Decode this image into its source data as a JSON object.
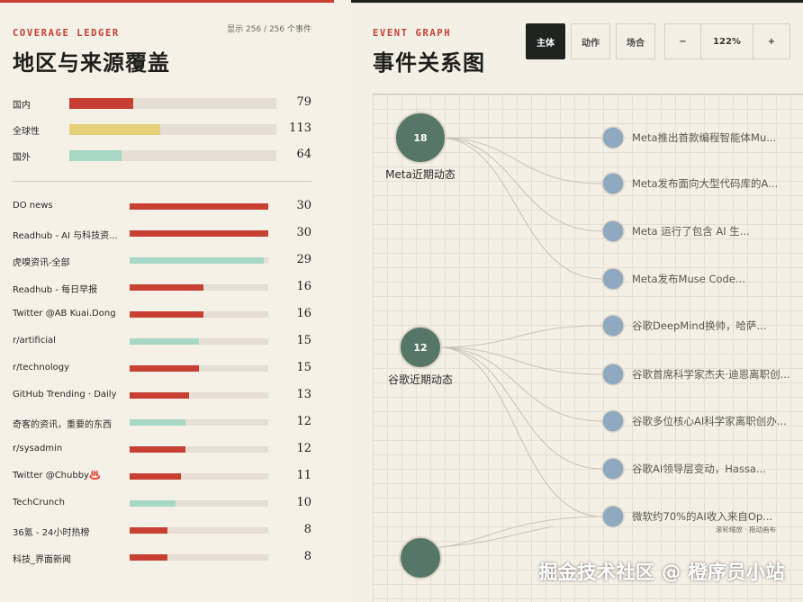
{
  "coverage": {
    "kicker": "COVERAGE LEDGER",
    "title": "地区与来源覆盖",
    "count_text": "显示 256 / 256 个事件",
    "regions": [
      {
        "label": "国内",
        "value": 79,
        "fraction": 0.31,
        "color": "#c83f33"
      },
      {
        "label": "全球性",
        "value": 113,
        "fraction": 0.44,
        "color": "#e8cf7a"
      },
      {
        "label": "国外",
        "value": 64,
        "fraction": 0.25,
        "color": "#a7d8c5"
      }
    ],
    "sources": [
      {
        "label": "DO news",
        "value": 30,
        "fraction": 1.0,
        "color": "#c83f33"
      },
      {
        "label": "Readhub - AI 与科技资...",
        "value": 30,
        "fraction": 1.0,
        "color": "#c83f33"
      },
      {
        "label": "虎嗅资讯-全部",
        "value": 29,
        "fraction": 0.97,
        "color": "#a7d8c5"
      },
      {
        "label": "Readhub - 每日早报",
        "value": 16,
        "fraction": 0.53,
        "color": "#c83f33"
      },
      {
        "label": "Twitter @AB Kuai.Dong",
        "value": 16,
        "fraction": 0.53,
        "color": "#c83f33"
      },
      {
        "label": "r/artificial",
        "value": 15,
        "fraction": 0.5,
        "color": "#a7d8c5"
      },
      {
        "label": "r/technology",
        "value": 15,
        "fraction": 0.5,
        "color": "#c83f33"
      },
      {
        "label": "GitHub Trending · Daily",
        "value": 13,
        "fraction": 0.43,
        "color": "#c83f33"
      },
      {
        "label": "奇客的资讯，重要的东西",
        "value": 12,
        "fraction": 0.4,
        "color": "#a7d8c5"
      },
      {
        "label": "r/sysadmin",
        "value": 12,
        "fraction": 0.4,
        "color": "#c83f33"
      },
      {
        "label": "Twitter @Chubby♨️",
        "value": 11,
        "fraction": 0.37,
        "color": "#c83f33"
      },
      {
        "label": "TechCrunch",
        "value": 10,
        "fraction": 0.33,
        "color": "#a7d8c5"
      },
      {
        "label": "36氪 - 24小时热榜",
        "value": 8,
        "fraction": 0.27,
        "color": "#c83f33"
      },
      {
        "label": "科技_界面新闻",
        "value": 8,
        "fraction": 0.27,
        "color": "#c83f33"
      }
    ]
  },
  "graph": {
    "kicker": "EVENT GRAPH",
    "title": "事件关系图",
    "modes": [
      "主体",
      "动作",
      "场合"
    ],
    "active_mode": "主体",
    "zoom_out": "−",
    "zoom_level": "122%",
    "zoom_in": "+",
    "hint": "滚轮缩放 · 拖动画布",
    "hubs": [
      {
        "count": "18",
        "label": "Meta近期动态"
      },
      {
        "count": "12",
        "label": "谷歌近期动态"
      }
    ],
    "events": [
      "Meta推出首款编程智能体Mu...",
      "Meta发布面向大型代码库的A...",
      "Meta 运行了包含 AI 生...",
      "Meta发布Muse Code...",
      "谷歌DeepMind换帅，哈萨...",
      "谷歌首席科学家杰夫·迪恩离职创...",
      "谷歌多位核心AI科学家离职创办...",
      "谷歌AI领导层变动，Hassa...",
      "微软约70%的AI收入来自Op..."
    ],
    "colors": {
      "hub": "#567767",
      "event": "#8fa9c1",
      "edge": "#c9c4b8"
    }
  },
  "watermark": "掘金技术社区 @ 橙序员小站"
}
